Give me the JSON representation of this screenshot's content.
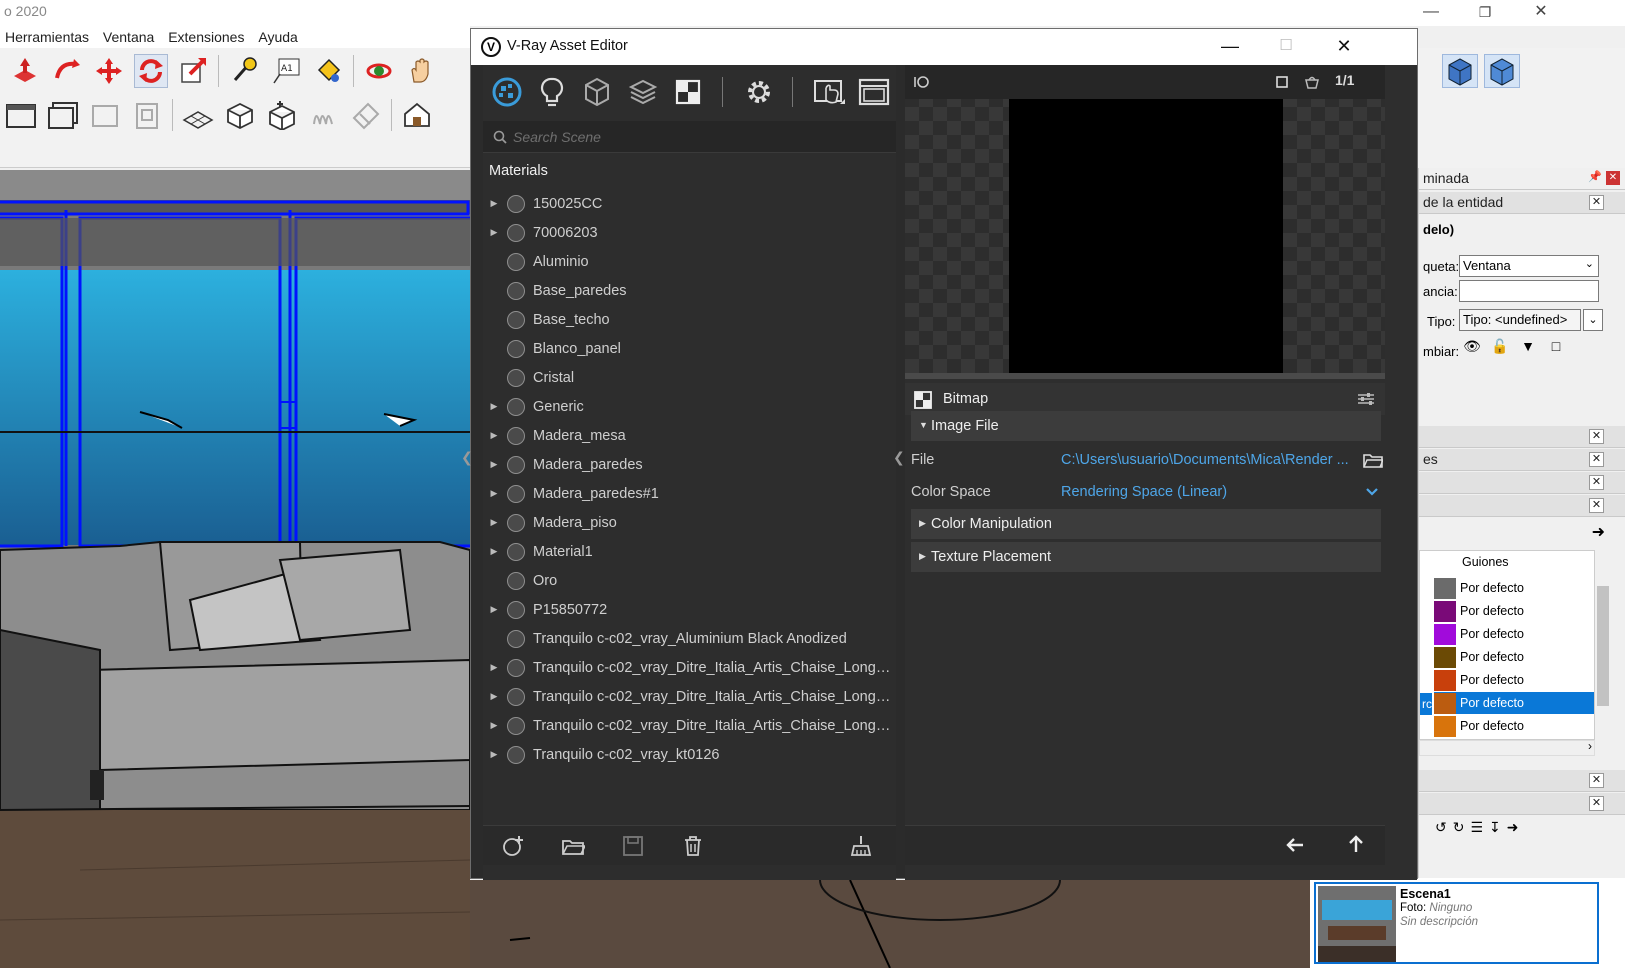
{
  "sketchup": {
    "title_fragment": "o 2020",
    "menu": [
      "Herramientas",
      "Ventana",
      "Extensiones",
      "Ayuda"
    ],
    "tray": {
      "panel_title": "minada",
      "entity_info_title": "de la entidad",
      "model_label": "delo)",
      "tag_label": "queta:",
      "tag_value": "Ventana",
      "instance_label": "ancia:",
      "instance_value": "",
      "type_label": "Tipo:",
      "type_value": "Tipo: <undefined>",
      "toggle_label": "mbiar:",
      "panel_fragment": "es",
      "layers_header": "Guiones",
      "layer_row_fragment": "rc",
      "layers": [
        {
          "label": "Por defecto",
          "color": "#6b6b6b"
        },
        {
          "label": "Por defecto",
          "color": "#7a0a78"
        },
        {
          "label": "Por defecto",
          "color": "#a10bdb"
        },
        {
          "label": "Por defecto",
          "color": "#6b4a05"
        },
        {
          "label": "Por defecto",
          "color": "#c8400c"
        },
        {
          "label": "Por defecto",
          "color": "#bb5c10",
          "selected": true
        },
        {
          "label": "Por defecto",
          "color": "#d8740c"
        }
      ]
    },
    "scene": {
      "name": "Escena1",
      "photo_label": "Foto:",
      "photo_value": "Ninguno",
      "description": "Sin descripción"
    }
  },
  "vray": {
    "title": "V-Ray Asset Editor",
    "search_placeholder": "Search Scene",
    "materials_header": "Materials",
    "materials": [
      {
        "name": "150025CC",
        "expandable": true
      },
      {
        "name": "70006203",
        "expandable": true
      },
      {
        "name": "Aluminio",
        "expandable": false
      },
      {
        "name": "Base_paredes",
        "expandable": false
      },
      {
        "name": "Base_techo",
        "expandable": false
      },
      {
        "name": "Blanco_panel",
        "expandable": false
      },
      {
        "name": "Cristal",
        "expandable": false
      },
      {
        "name": "Generic",
        "expandable": true
      },
      {
        "name": "Madera_mesa",
        "expandable": true
      },
      {
        "name": "Madera_paredes",
        "expandable": true
      },
      {
        "name": "Madera_paredes#1",
        "expandable": true
      },
      {
        "name": "Madera_piso",
        "expandable": true
      },
      {
        "name": "Material1",
        "expandable": true
      },
      {
        "name": "Oro",
        "expandable": false
      },
      {
        "name": "P15850772",
        "expandable": true
      },
      {
        "name": "Tranquilo c-c02_vray_Aluminium Black Anodized",
        "expandable": false
      },
      {
        "name": "Tranquilo c-c02_vray_Ditre_Italia_Artis_Chaise_Longue...",
        "expandable": true
      },
      {
        "name": "Tranquilo c-c02_vray_Ditre_Italia_Artis_Chaise_Longue...",
        "expandable": true
      },
      {
        "name": "Tranquilo c-c02_vray_Ditre_Italia_Artis_Chaise_Longue...",
        "expandable": true
      },
      {
        "name": "Tranquilo c-c02_vray_kt0126",
        "expandable": true
      }
    ],
    "preview_zoom": "1/1",
    "bitmap": {
      "title": "Bitmap",
      "image_file_section": "Image File",
      "file_label": "File",
      "file_value": "C:\\Users\\usuario\\Documents\\Mica\\Render ...",
      "color_space_label": "Color Space",
      "color_space_value": "Rendering Space (Linear)",
      "color_manipulation_section": "Color Manipulation",
      "texture_placement_section": "Texture Placement"
    }
  }
}
